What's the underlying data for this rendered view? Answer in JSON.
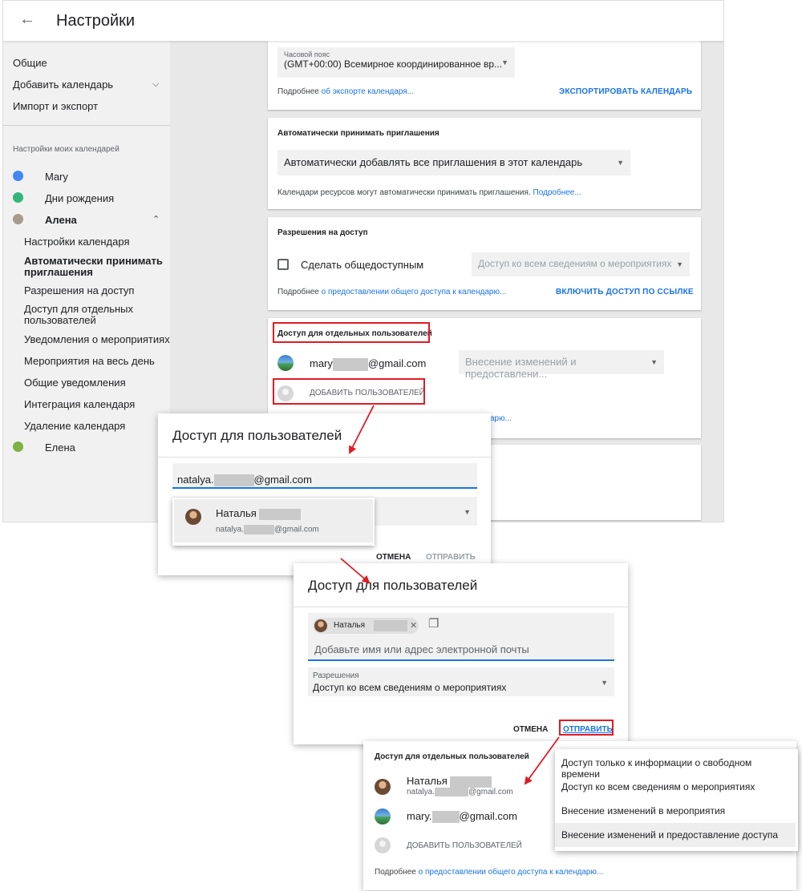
{
  "header": {
    "back_icon": "←",
    "title": "Настройки"
  },
  "sidebar": {
    "general": "Общие",
    "add_calendar": "Добавить календарь",
    "import_export": "Импорт и экспорт",
    "my_calendars_heading": "Настройки моих календарей",
    "calendars": [
      {
        "name": "Mary",
        "color": "#4285f4"
      },
      {
        "name": "Дни рождения",
        "color": "#33b679"
      },
      {
        "name": "Алена",
        "color": "#a79b8e"
      }
    ],
    "sub_items": [
      "Настройки календаря",
      "Автоматически принимать приглашения",
      "Разрешения на доступ",
      "Доступ для отдельных пользователей",
      "Уведомления о мероприятиях",
      "Мероприятия на весь день",
      "Общие уведомления",
      "Интеграция календаря",
      "Удаление календаря"
    ],
    "last_calendar": {
      "name": "Елена",
      "color": "#7cb342"
    }
  },
  "export_card": {
    "tz_label": "Часовой пояс",
    "tz_value": "(GMT+00:00) Всемирное координированное вр...",
    "more_prefix": "Подробнее ",
    "more_link": "об экспорте календаря...",
    "export_button": "ЭКСПОРТИРОВАТЬ КАЛЕНДАРЬ"
  },
  "auto_accept_card": {
    "title": "Автоматически принимать приглашения",
    "select_value": "Автоматически добавлять все приглашения в этот календарь",
    "note": "Календари ресурсов могут автоматически принимать приглашения. ",
    "note_link": "Подробнее..."
  },
  "permissions_card": {
    "title": "Разрешения на доступ",
    "public_label": "Сделать общедоступным",
    "public_select": "Доступ ко всем сведениям о мероприятиях",
    "more_prefix": "Подробнее ",
    "more_link": "о предоставлении общего доступа к календарю...",
    "link_button": "ВКЛЮЧИТЬ ДОСТУП ПО ССЫЛКЕ"
  },
  "users_card": {
    "title": "Доступ для отдельных пользователей",
    "user_prefix": "mary",
    "user_suffix": "@gmail.com",
    "user_perm": "Внесение изменений и предоставлени...",
    "add_users": "ДОБАВИТЬ ПОЛЬЗОВАТЕЛЕЙ",
    "more_link_tail": "арю..."
  },
  "dialog1": {
    "title": "Доступ для пользователей",
    "input_prefix": "natalya.",
    "input_suffix": "@gmail.com",
    "suggestion_name": "Наталья",
    "suggestion_email_prefix": "natalya.",
    "suggestion_email_suffix": "@gmail.com",
    "cancel": "ОТМЕНА",
    "send": "ОТПРАВИТЬ"
  },
  "dialog2": {
    "title": "Доступ для пользователей",
    "chip_name": "Наталья",
    "chip_close": "✕",
    "copy_icon": "❐",
    "input_placeholder": "Добавьте имя или адрес электронной почты",
    "perm_label": "Разрешения",
    "perm_value": "Доступ ко всем сведениям о мероприятиях",
    "cancel": "ОТМЕНА",
    "send": "ОТПРАВИТЬ"
  },
  "panel3": {
    "title": "Доступ для отдельных пользователей",
    "user1_name": "Наталья",
    "user1_email_prefix": "natalya.",
    "user1_email_suffix": "@gmail.com",
    "user2_prefix": "mary.",
    "user2_suffix": "@gmail.com",
    "add_users": "ДОБАВИТЬ ПОЛЬЗОВАТЕЛЕЙ",
    "more_prefix": "Подробнее ",
    "more_link": "о предоставлении общего доступа к календарю..."
  },
  "menu": {
    "options": [
      "Доступ только к информации о свободном времени",
      "Доступ ко всем сведениям о мероприятиях",
      "Внесение изменений в мероприятия",
      "Внесение изменений и предоставление доступа"
    ],
    "selected_index": 3
  },
  "colors": {
    "accent": "#1a73e8",
    "highlight": "#e01b24"
  }
}
